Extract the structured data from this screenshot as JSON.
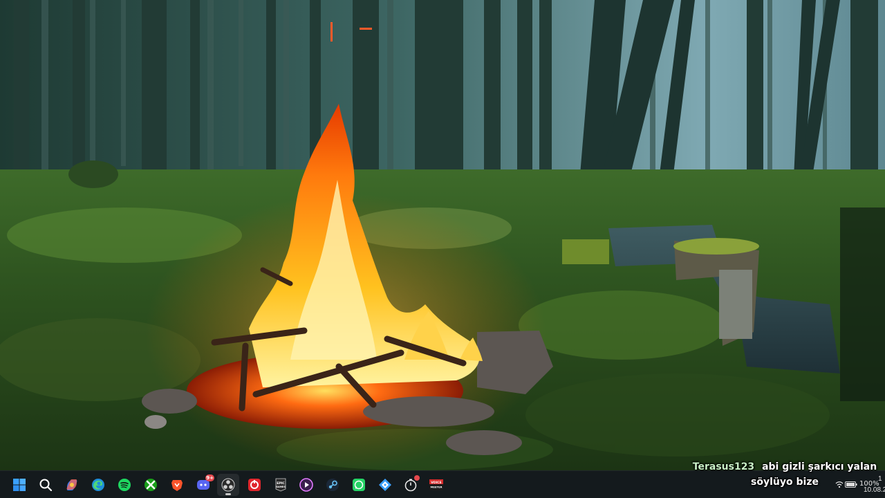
{
  "overlay": {
    "chat_user": "Terasus123",
    "chat_message_line1": "abi gizli şarkıcı yalan",
    "chat_message_line2": "söylüyo bize"
  },
  "taskbar": {
    "items": [
      {
        "name": "windows-start-icon",
        "active": false
      },
      {
        "name": "search-icon",
        "active": false
      },
      {
        "name": "copilot-icon",
        "active": false
      },
      {
        "name": "edge-browser-icon",
        "active": false
      },
      {
        "name": "spotify-icon",
        "active": false
      },
      {
        "name": "xbox-icon",
        "active": false
      },
      {
        "name": "brave-browser-icon",
        "active": false
      },
      {
        "name": "discord-icon",
        "active": false,
        "badge": "9+"
      },
      {
        "name": "obs-studio-icon",
        "active": true
      },
      {
        "name": "razer-cortex-icon",
        "active": false
      },
      {
        "name": "epic-games-launcher-icon",
        "active": false,
        "label": "EPIC\nGAMES"
      },
      {
        "name": "media-player-icon",
        "active": false
      },
      {
        "name": "steam-icon",
        "active": false
      },
      {
        "name": "whatsapp-icon",
        "active": false
      },
      {
        "name": "app-launcher-icon",
        "active": false
      },
      {
        "name": "stopwatch-app-icon",
        "active": false,
        "dot": true
      },
      {
        "name": "voicemeeter-icon",
        "active": false,
        "label": "VOICE\nMEETER"
      }
    ],
    "accent_color": "#1f8cf0"
  },
  "tray": {
    "battery_percent": "100%",
    "clock_time": "1",
    "clock_date": "10.08.2"
  }
}
